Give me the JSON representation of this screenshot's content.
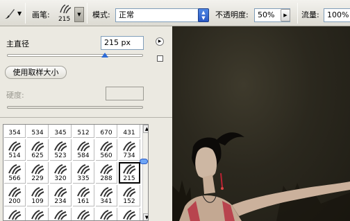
{
  "options_bar": {
    "tool_icon": "brush-icon",
    "brush_label": "画笔:",
    "brush_size": "215",
    "mode_label": "模式:",
    "mode_value": "正常",
    "opacity_label": "不透明度:",
    "opacity_value": "50%",
    "flow_label": "流量:",
    "flow_value": "100%"
  },
  "brush_panel": {
    "diameter_label": "主直径",
    "diameter_value": "215 px",
    "diameter_fraction": 0.72,
    "use_sample_size_label": "使用取样大小",
    "hardness_label": "硬度:",
    "hardness_value": "",
    "brushes": [
      [
        "354",
        "534",
        "345",
        "512",
        "670",
        "431"
      ],
      [
        "514",
        "625",
        "523",
        "584",
        "560",
        "734"
      ],
      [
        "566",
        "229",
        "320",
        "335",
        "288",
        "215"
      ],
      [
        "200",
        "109",
        "234",
        "161",
        "341",
        "152"
      ],
      [
        "",
        "",
        "",
        "",
        "",
        ""
      ]
    ],
    "selected_brush": "215"
  },
  "colors": {
    "accent": "#2e6bd6",
    "canvas_bg": "#2b281e",
    "panel_bg": "#ebe9e1"
  }
}
